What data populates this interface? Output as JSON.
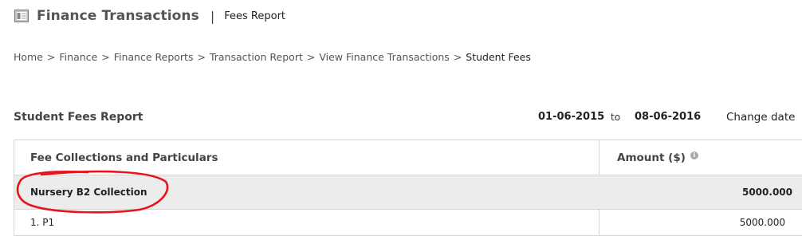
{
  "header": {
    "app_icon": "receipt-icon",
    "title": "Finance Transactions",
    "separator": "|",
    "subtitle": "Fees Report"
  },
  "breadcrumb": {
    "items": [
      "Home",
      "Finance",
      "Finance Reports",
      "Transaction Report",
      "View Finance Transactions"
    ],
    "separator": ">",
    "current": "Student Fees"
  },
  "report": {
    "title": "Student Fees Report",
    "date_from": "01-06-2015",
    "to_label": "to",
    "date_to": "08-06-2016",
    "change_date": "Change date"
  },
  "table": {
    "headers": {
      "name": "Fee Collections and Particulars",
      "amount": "Amount ($)",
      "amount_info_icon": "info-icon"
    },
    "group": {
      "name": "Nursery B2 Collection",
      "amount": "5000.000"
    },
    "items": [
      {
        "name": "1. P1",
        "amount": "5000.000"
      }
    ]
  },
  "colors": {
    "annotation_circle": "#e8141c",
    "group_row_bg": "#ececec",
    "border": "#d6d6d6"
  }
}
